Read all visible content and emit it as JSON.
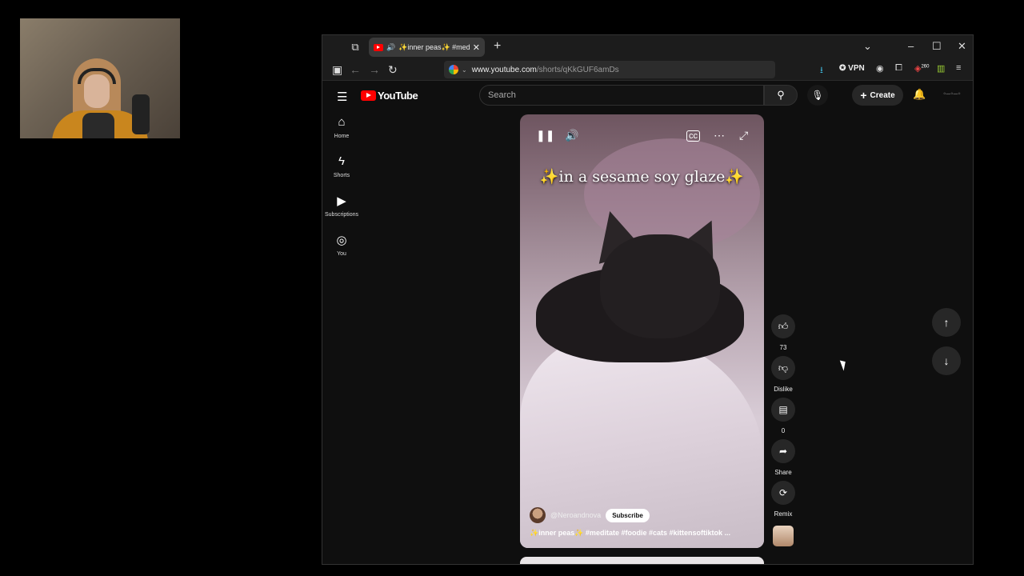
{
  "tab": {
    "title": "✨inner peas✨ #meditate #foodie #cats #kittensoftiktok",
    "close": "✕",
    "new_tab": "+"
  },
  "window_controls": {
    "dropdown": "⌄",
    "minimize": "–",
    "maximize": "☐",
    "close": "✕"
  },
  "address": {
    "host": "www.youtube.com",
    "path": "/shorts/qKkGUF6amDs"
  },
  "toolbar": {
    "vpn": "VPN",
    "badge_count": "260"
  },
  "header": {
    "logo_text": "YouTube",
    "search_placeholder": "Search",
    "create_label": "Create"
  },
  "sidebar": {
    "items": [
      {
        "label": "Home",
        "icon": "home-icon"
      },
      {
        "label": "Shorts",
        "icon": "shorts-icon"
      },
      {
        "label": "Subscriptions",
        "icon": "subscriptions-icon"
      },
      {
        "label": "You",
        "icon": "you-icon"
      }
    ]
  },
  "video": {
    "caption": "✨in a sesame soy glaze✨",
    "channel": "@Neroandnova",
    "subscribe_label": "Subscribe",
    "title": "✨inner peas✨ #meditate #foodie #cats #kittensoftiktok ..."
  },
  "actions": {
    "like_count": "73",
    "dislike_label": "Dislike",
    "comment_count": "0",
    "share_label": "Share",
    "remix_label": "Remix"
  }
}
